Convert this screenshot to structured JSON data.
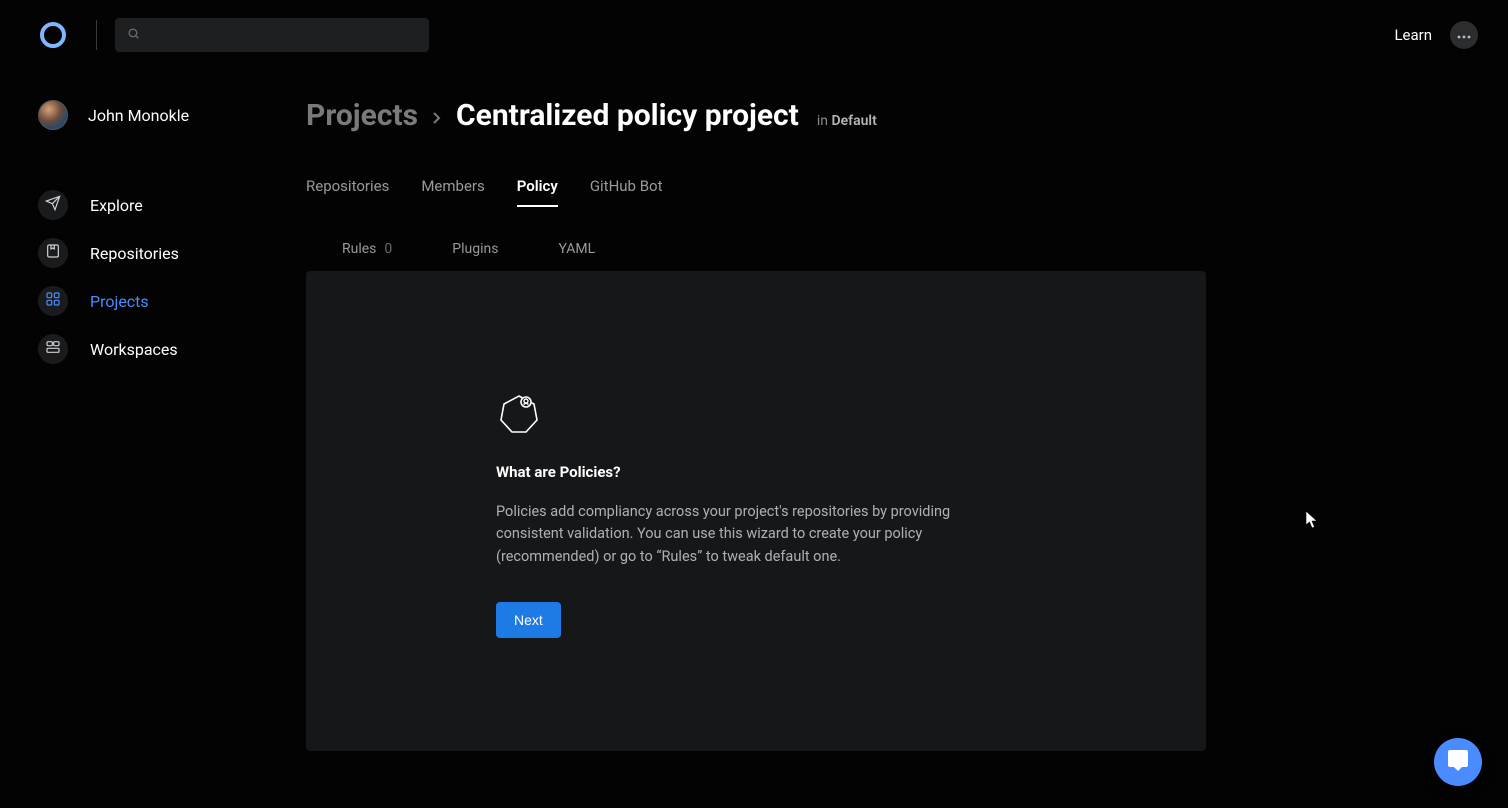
{
  "topbar": {
    "learn_label": "Learn",
    "search_placeholder": ""
  },
  "user": {
    "name": "John Monokle"
  },
  "sidebar": {
    "items": [
      {
        "id": "explore",
        "label": "Explore"
      },
      {
        "id": "repositories",
        "label": "Repositories"
      },
      {
        "id": "projects",
        "label": "Projects"
      },
      {
        "id": "workspaces",
        "label": "Workspaces"
      }
    ]
  },
  "breadcrumb": {
    "root": "Projects",
    "title": "Centralized policy project",
    "in_prefix": "in",
    "in_target": "Default"
  },
  "tabs": [
    {
      "id": "repositories",
      "label": "Repositories"
    },
    {
      "id": "members",
      "label": "Members"
    },
    {
      "id": "policy",
      "label": "Policy"
    },
    {
      "id": "github-bot",
      "label": "GitHub Bot"
    }
  ],
  "subtabs": {
    "rules": {
      "label": "Rules",
      "count": "0"
    },
    "plugins": {
      "label": "Plugins"
    },
    "yaml": {
      "label": "YAML"
    }
  },
  "panel": {
    "heading": "What are Policies?",
    "body": "Policies add compliancy across your project's repositories by providing consistent validation. You can use this wizard to create your policy (recommended) or go to “Rules” to tweak default one.",
    "next_label": "Next"
  }
}
